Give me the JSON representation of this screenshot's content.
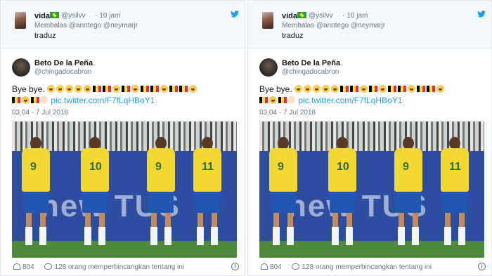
{
  "reply": {
    "name": "vida",
    "flag_icon": "brazil-flag-icon",
    "handle": "@ysilvv",
    "time": "10 jam",
    "replying_to": "Membalas @anntego @neymarjr",
    "text": "traduz"
  },
  "tweet": {
    "name": "Beto De la Peña",
    "handle": "@chingadocabron",
    "text_prefix": "Bye bye.",
    "emoji_line1": [
      "laugh",
      "laugh",
      "laugh",
      "laugh",
      "laugh",
      "belgium",
      "belgium",
      "laugh",
      "belgium",
      "laugh",
      "belgium",
      "belgium",
      "laugh",
      "belgium",
      "belgium",
      "laugh"
    ],
    "emoji_line2": [
      "belgium",
      "laugh",
      "belgium",
      "peace"
    ],
    "link": "pic.twitter.com/F7fLqHBoY1",
    "date": "03.04 - 7 Jul 2018",
    "likes": "804",
    "conversation": "128 orang memperbincangkan tentang ini",
    "photo_board_text": "new TUS"
  },
  "colors": {
    "link": "#1da1f2",
    "brazil_yellow": "#f4d832",
    "brazil_blue": "#1f57b3",
    "twitter_blue": "#1da1f2"
  },
  "icons": [
    "twitter-bird-icon",
    "heart-icon",
    "comment-icon",
    "info-icon"
  ]
}
